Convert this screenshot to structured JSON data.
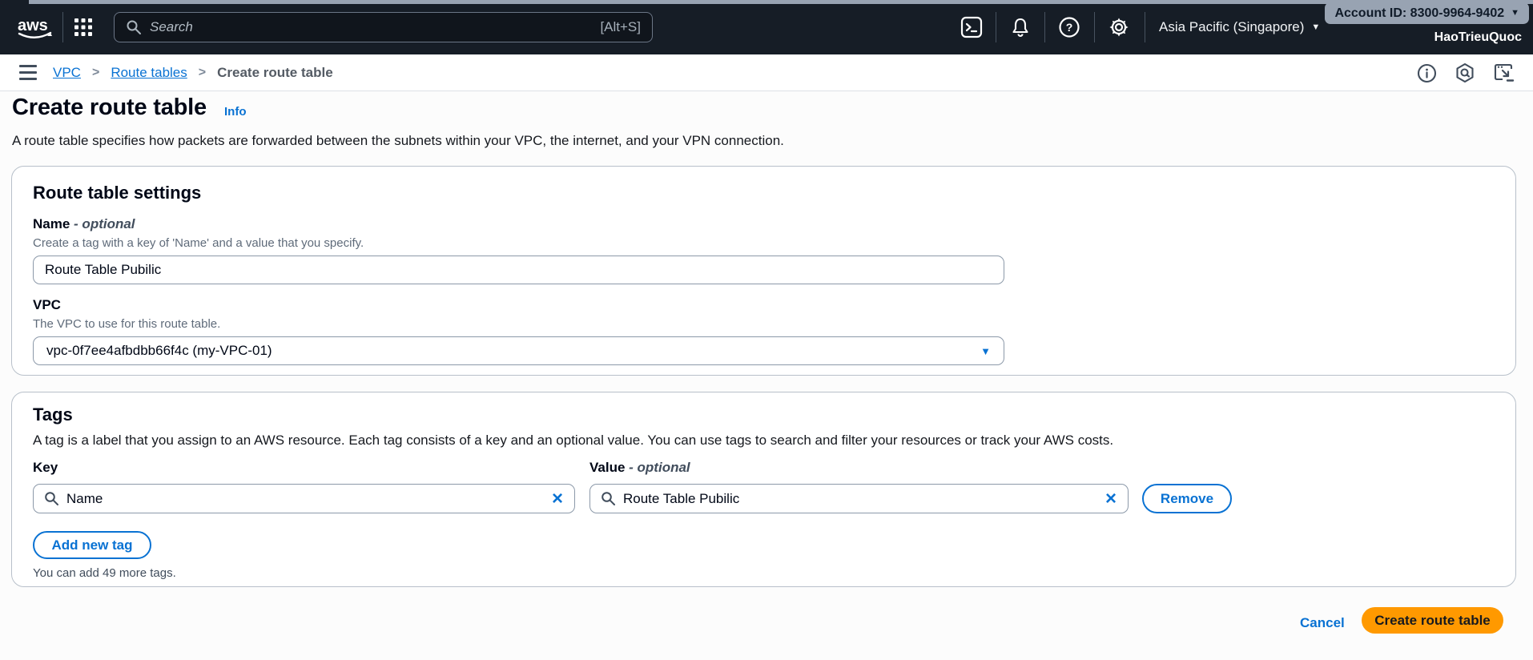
{
  "header": {
    "logo_text": "aws",
    "search_placeholder": "Search",
    "search_shortcut": "[Alt+S]",
    "region_label": "Asia Pacific (Singapore)",
    "account_id_label": "Account ID: 8300-9964-9402",
    "username": "HaoTrieuQuoc"
  },
  "icons": {
    "header": [
      "apps-grid-icon",
      "search-icon",
      "cloudshell-terminal-icon",
      "bell-icon",
      "help-icon",
      "gear-icon"
    ],
    "breadcrumb_right": [
      "info-circle-icon",
      "amazon-q-hexagon-icon",
      "feedback-panel-icon"
    ]
  },
  "breadcrumb": {
    "separator": ">",
    "items": [
      {
        "label": "VPC"
      },
      {
        "label": "Route tables"
      },
      {
        "label": "Create route table"
      }
    ]
  },
  "page": {
    "title": "Create route table",
    "info_link": "Info",
    "description": "A route table specifies how packets are forwarded between the subnets within your VPC, the internet, and your VPN connection."
  },
  "route_table_settings": {
    "title": "Route table settings",
    "name_label": "Name",
    "name_optional": "- optional",
    "name_description": "Create a tag with a key of 'Name' and a value that you specify.",
    "name_value": "Route Table Pubilic",
    "vpc_label": "VPC",
    "vpc_description": "The VPC to use for this route table.",
    "vpc_selected": "vpc-0f7ee4afbdbb66f4c (my-VPC-01)"
  },
  "tags": {
    "title": "Tags",
    "description": "A tag is a label that you assign to an AWS resource. Each tag consists of a key and an optional value. You can use tags to search and filter your resources or track your AWS costs.",
    "key_label": "Key",
    "value_label": "Value",
    "value_optional": "- optional",
    "key_value": "Name",
    "value_value": "Route Table Pubilic",
    "remove_button": "Remove",
    "add_button": "Add new tag",
    "note": "You can add 49 more tags."
  },
  "footer": {
    "cancel_label": "Cancel",
    "create_label": "Create route table"
  },
  "colors": {
    "header_bg": "#161d26",
    "accent_blue": "#0972d3",
    "primary_orange": "#ff9900",
    "card_border": "#b8c0ca"
  }
}
